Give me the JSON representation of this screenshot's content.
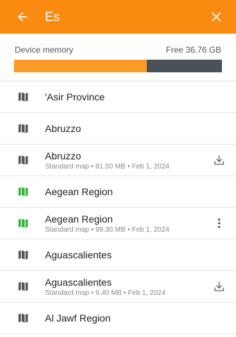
{
  "header": {
    "title": "Es",
    "accent": "#fb8a10"
  },
  "memory": {
    "label": "Device memory",
    "free": "Free 36.76 GB",
    "used_fraction": 0.64
  },
  "items": [
    {
      "name": "'Asir Province",
      "detail": "",
      "icon": "map-icon",
      "color": "#555555",
      "action": ""
    },
    {
      "name": "Abruzzo",
      "detail": "",
      "icon": "map-icon",
      "color": "#555555",
      "action": ""
    },
    {
      "name": "Abruzzo",
      "detail": "Standard map • 81.50 MB • Feb 1, 2024",
      "icon": "map-icon",
      "color": "#555555",
      "action": "download-icon"
    },
    {
      "name": "Aegean Region",
      "detail": "",
      "icon": "map-icon",
      "color": "#2fb83a",
      "action": ""
    },
    {
      "name": "Aegean Region",
      "detail": "Standard map • 99.30 MB • Feb 1, 2024",
      "icon": "map-icon",
      "color": "#2fb83a",
      "action": "more-icon"
    },
    {
      "name": "Aguascalientes",
      "detail": "",
      "icon": "map-icon",
      "color": "#555555",
      "action": ""
    },
    {
      "name": "Aguascalientes",
      "detail": "Standard map • 9.40 MB • Feb 1, 2024",
      "icon": "map-icon",
      "color": "#555555",
      "action": "download-icon"
    },
    {
      "name": "Al Jawf Region",
      "detail": "",
      "icon": "map-icon",
      "color": "#555555",
      "action": ""
    }
  ]
}
